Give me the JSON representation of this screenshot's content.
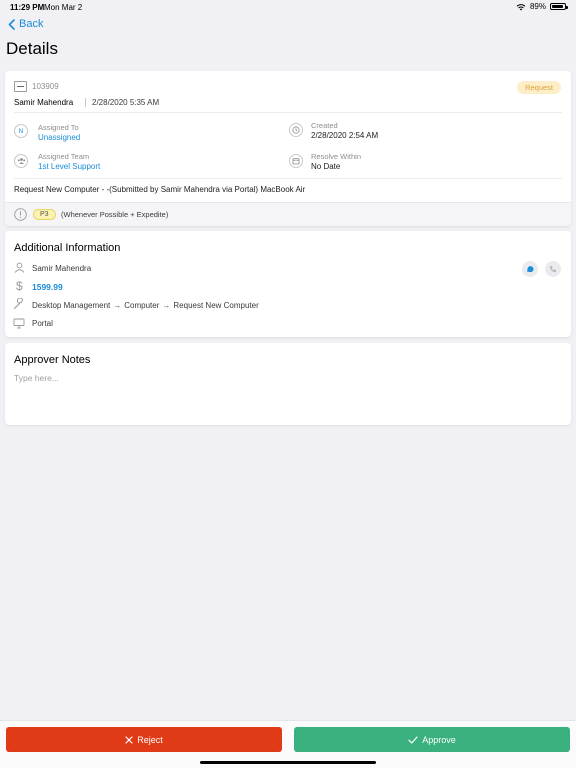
{
  "status_bar": {
    "time": "11:29 PM",
    "date": "Mon Mar 2",
    "battery": "89%",
    "battery_level": 0.89
  },
  "nav": {
    "back_label": "Back",
    "title": "Details"
  },
  "ticket": {
    "id": "103909",
    "type_badge": "Request",
    "requester": "Samir Mahendra",
    "requested_at": "2/28/2020 5:35 AM",
    "assigned_to_label": "Assigned To",
    "assigned_to_initial": "N",
    "assigned_to_value": "Unassigned",
    "created_label": "Created",
    "created_value": "2/28/2020 2:54 AM",
    "assigned_team_label": "Assigned Team",
    "assigned_team_value": "1st Level Support",
    "resolve_label": "Resolve Within",
    "resolve_value": "No Date",
    "description": "Request New Computer  - -(Submitted by Samir Mahendra via Portal) MacBook Air",
    "priority_badge": "P3",
    "priority_text": "(Whenever Possible + Expedite)"
  },
  "additional": {
    "title": "Additional Information",
    "person": "Samir Mahendra",
    "amount": "1599.99",
    "category": [
      "Desktop Management",
      "Computer",
      "Request New Computer"
    ],
    "source": "Portal"
  },
  "notes": {
    "title": "Approver Notes",
    "placeholder": "Type here..."
  },
  "actions": {
    "reject_label": "Reject",
    "approve_label": "Approve"
  },
  "colors": {
    "accent": "#1a8cd8",
    "reject": "#e03a17",
    "approve": "#3ab07f",
    "badge_bg": "#fdeec7",
    "priority_bg": "#fdf3b0"
  }
}
